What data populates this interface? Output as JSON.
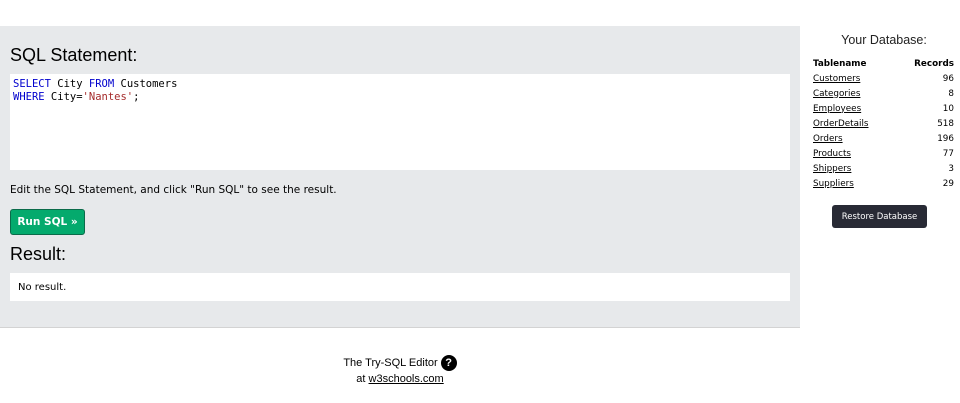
{
  "main": {
    "sql_title": "SQL Statement:",
    "sql_line1": {
      "kw1": "SELECT",
      "t1": " City ",
      "kw2": "FROM",
      "t2": " Customers"
    },
    "sql_line2": {
      "kw1": "WHERE",
      "t1": " City=",
      "str": "'Nantes'",
      "t2": ";"
    },
    "instruction": "Edit the SQL Statement, and click \"Run SQL\" to see the result.",
    "run_label": "Run SQL »",
    "result_title": "Result:",
    "result_text": "No result."
  },
  "sidebar": {
    "title": "Your Database:",
    "col_tablename": "Tablename",
    "col_records": "Records",
    "tables": [
      {
        "name": "Customers",
        "records": "96"
      },
      {
        "name": "Categories",
        "records": "8"
      },
      {
        "name": "Employees",
        "records": "10"
      },
      {
        "name": "OrderDetails",
        "records": "518"
      },
      {
        "name": "Orders",
        "records": "196"
      },
      {
        "name": "Products",
        "records": "77"
      },
      {
        "name": "Shippers",
        "records": "3"
      },
      {
        "name": "Suppliers",
        "records": "29"
      }
    ],
    "restore_label": "Restore Database"
  },
  "footer": {
    "line1": "The Try-SQL Editor",
    "help_icon": "?",
    "at": "at ",
    "link": "w3schools.com"
  },
  "colors": {
    "run_button": "#04aa6d",
    "restore_button": "#282a35",
    "keyword": "#0000cd",
    "string": "#a52a2a",
    "panel_bg": "#e7e9eb"
  }
}
